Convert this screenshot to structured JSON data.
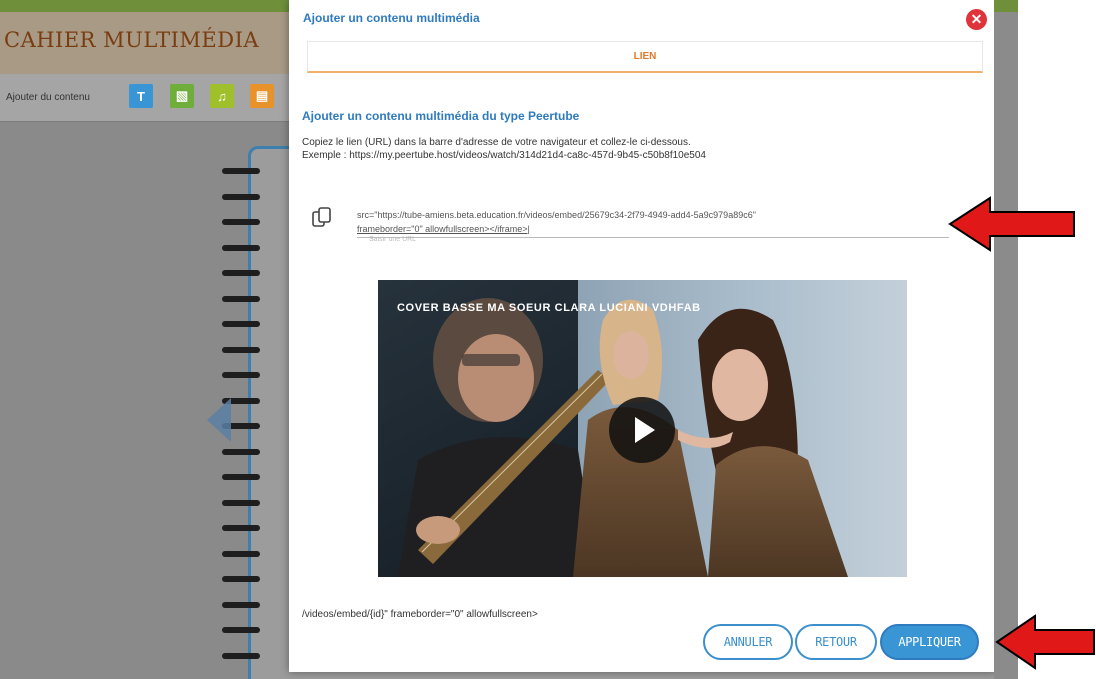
{
  "app": {
    "title": "CAHIER MULTIMÉDIA",
    "toolbar": {
      "add_content_label": "Ajouter du contenu",
      "tools": [
        {
          "name": "text-tool",
          "glyph": "T",
          "color": "#3a95d4"
        },
        {
          "name": "image-tool",
          "glyph": "▧",
          "color": "#6fae3a"
        },
        {
          "name": "audio-tool",
          "glyph": "♫",
          "color": "#9fc02b"
        },
        {
          "name": "document-tool",
          "glyph": "▤",
          "color": "#e8922b"
        }
      ]
    }
  },
  "modal": {
    "title": "Ajouter un contenu multimédia",
    "tab_label": "LIEN",
    "section_heading": "Ajouter un contenu multimédia du type Peertube",
    "instruction_line1": "Copiez le lien (URL) dans la barre d'adresse de votre navigateur et collez-le ci-dessous.",
    "instruction_line2": "Exemple : https://my.peertube.host/videos/watch/314d21d4-ca8c-457d-9b45-c50b8f10e504",
    "url_value_line1": "src=\"https://tube-amiens.beta.education.fr/videos/embed/25679c34-2f79-4949-add4-5a9c979a89c6\"",
    "url_value_line2": "frameborder=\"0\" allowfullscreen></iframe>|",
    "input_hint": "Saisir une URL",
    "video_title": "COVER BASSE MA SOEUR CLARA LUCIANI VDHFAB",
    "embed_code": "/videos/embed/{id}\" frameborder=\"0\" allowfullscreen>",
    "buttons": {
      "cancel": "ANNULER",
      "back": "RETOUR",
      "apply": "APPLIQUER"
    }
  },
  "colors": {
    "accent_blue": "#2f7bbf",
    "tab_orange": "#e07a2b",
    "close_red": "#e0343c",
    "annotation_red": "#e01818"
  }
}
